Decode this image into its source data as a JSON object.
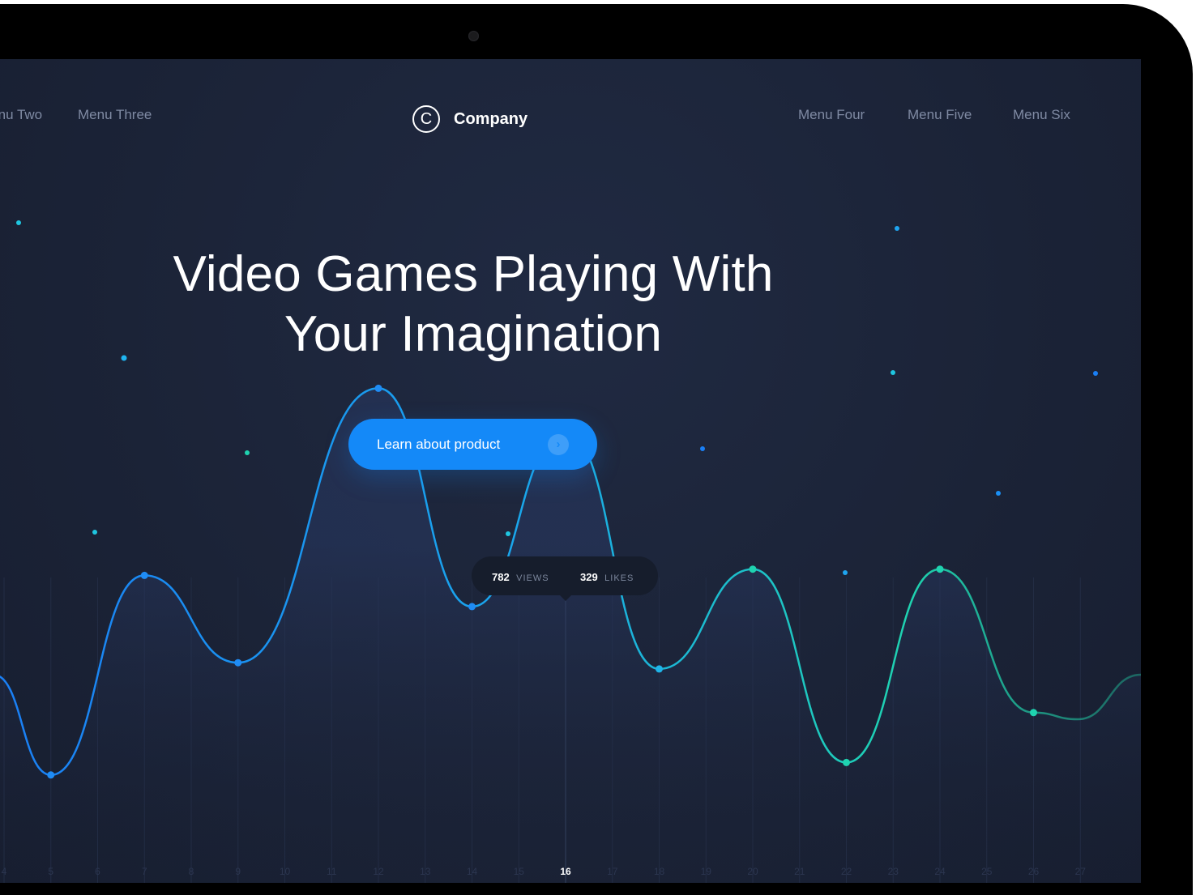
{
  "nav": {
    "left": [
      "Menu Two",
      "Menu Three"
    ],
    "right": [
      "Menu Four",
      "Menu Five",
      "Menu Six"
    ]
  },
  "logo": {
    "mark": "C",
    "name": "Company"
  },
  "hero": {
    "title_line1": "Video Games Playing With",
    "title_line2": "Your Imagination",
    "cta_label": "Learn about product",
    "cta_icon": "chevron-right-icon"
  },
  "tooltip": {
    "views": "782",
    "views_label": "VIEWS",
    "likes": "329",
    "likes_label": "LIKES"
  },
  "colors": {
    "background": "#1b2337",
    "accent_blue": "#1489f8",
    "accent_teal": "#1fd3b0",
    "text_muted": "#7f8aa3"
  },
  "chart_data": {
    "type": "line",
    "x": [
      5,
      7,
      9,
      12,
      14,
      16,
      18,
      20,
      22,
      24,
      26
    ],
    "series": [
      {
        "values": [
          16,
          48,
          34,
          78,
          43,
          71,
          33,
          49,
          18,
          49,
          26
        ]
      }
    ],
    "tick_labels": [
      "4",
      "5",
      "6",
      "7",
      "8",
      "9",
      "10",
      "11",
      "12",
      "13",
      "14",
      "15",
      "16",
      "17",
      "18",
      "19",
      "20",
      "21",
      "22",
      "23",
      "24",
      "25",
      "26",
      "27"
    ],
    "selected_x": 16,
    "xlim": [
      4,
      27
    ],
    "grid": false,
    "legend": "none"
  }
}
